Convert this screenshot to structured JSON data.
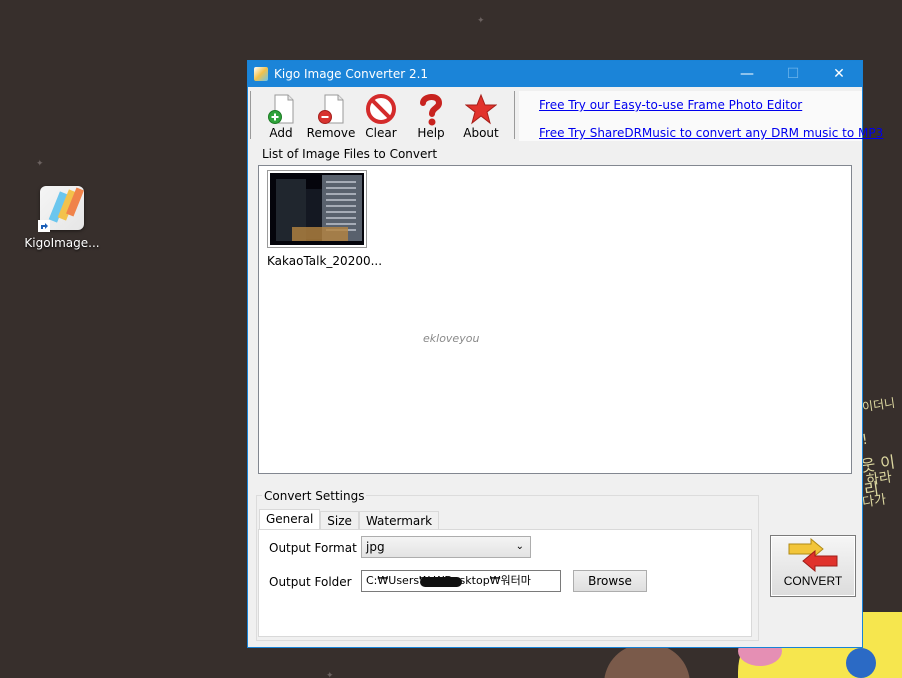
{
  "desktop": {
    "shortcut_label": "KigoImage...",
    "wallpaper_text": [
      "이더니",
      "!",
      "웃 이리",
      "하라",
      "다가"
    ]
  },
  "window": {
    "title": "Kigo Image Converter 2.1",
    "controls": {
      "minimize": "—",
      "maximize": "☐",
      "close": "✕"
    }
  },
  "toolbar": {
    "buttons": [
      {
        "label": "Add",
        "icon": "add-file-icon"
      },
      {
        "label": "Remove",
        "icon": "remove-file-icon"
      },
      {
        "label": "Clear",
        "icon": "no-entry-icon"
      },
      {
        "label": "Help",
        "icon": "question-mark-icon"
      },
      {
        "label": "About",
        "icon": "star-icon"
      }
    ],
    "promo_links": [
      "Free Try our Easy-to-use Frame Photo Editor",
      "Free Try ShareDRMusic to convert any DRM music to MP3"
    ]
  },
  "file_list": {
    "legend": "List of Image Files to Convert",
    "items": [
      {
        "name": "KakaoTalk_20200..."
      }
    ],
    "watermark": "ekloveyou"
  },
  "settings": {
    "legend": "Convert Settings",
    "tabs": [
      "General",
      "Size",
      "Watermark"
    ],
    "active_tab": "General",
    "output_format_label": "Output Format",
    "output_format_value": "jpg",
    "output_folder_label": "Output Folder",
    "output_folder_value": "C:₩Users₩        ₩Desktop₩워터마",
    "browse_label": "Browse"
  },
  "convert_button": {
    "label": "CONVERT"
  },
  "colors": {
    "titlebar": "#1b84d8",
    "link": "#0000ee",
    "desktop": "#372f2c"
  }
}
